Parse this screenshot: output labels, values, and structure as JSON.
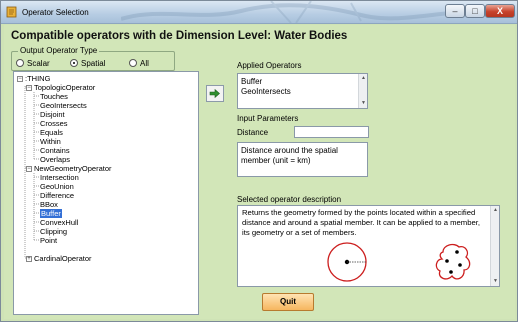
{
  "window": {
    "title": "Operator Selection",
    "controls": {
      "minimize": "–",
      "maximize": "□",
      "close": "X"
    }
  },
  "main_title": "Compatible operators with de Dimension Level: Water Bodies",
  "output_type": {
    "label": "Output Operator Type",
    "options": [
      "Scalar",
      "Spatial",
      "All"
    ],
    "selected": "Spatial"
  },
  "tree": {
    "root": ":THING",
    "groups": [
      {
        "label": "TopologicOperator",
        "expanded": true,
        "children": [
          "Touches",
          "GeoIntersects",
          "Disjoint",
          "Crosses",
          "Equals",
          "Within",
          "Contains",
          "Overlaps"
        ]
      },
      {
        "label": "NewGeometryOperator",
        "expanded": true,
        "children": [
          "Intersection",
          "GeoUnion",
          "Difference",
          "BBox",
          "Buffer",
          "ConvexHull",
          "Clipping",
          "Point"
        ]
      },
      {
        "label": "CardinalOperator",
        "expanded": false,
        "children": []
      }
    ],
    "selected": "Buffer"
  },
  "applied": {
    "label": "Applied Operators",
    "items": [
      "Buffer",
      "GeoIntersects"
    ]
  },
  "input_params": {
    "label": "Input Parameters",
    "distance_label": "Distance",
    "distance_value": "",
    "distance_desc": "Distance around the spatial member (unit = km)"
  },
  "description": {
    "label": "Selected operator description",
    "text": "Returns the geometry formed by the points located within a specified distance and around a spatial member. It can be applied to a member, its geometry or a set of members."
  },
  "quit_label": "Quit",
  "colors": {
    "background": "#d2e6b8",
    "selection": "#3470d6",
    "buffer_red": "#cc1e1e",
    "quit": "#f6b65f"
  },
  "icons": [
    "app-icon",
    "add-arrow-icon",
    "scroll-up-icon",
    "scroll-down-icon"
  ]
}
